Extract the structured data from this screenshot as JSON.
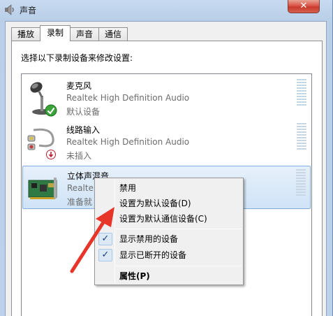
{
  "window": {
    "title": "声音",
    "close_glyph": "✕",
    "icon": "speaker-icon"
  },
  "tabs": [
    {
      "label": "播放",
      "active": false
    },
    {
      "label": "录制",
      "active": true
    },
    {
      "label": "声音",
      "active": false
    },
    {
      "label": "通信",
      "active": false
    }
  ],
  "recording": {
    "instruction": "选择以下录制设备来修改设置:",
    "devices": [
      {
        "name": "麦克风",
        "driver": "Realtek High Definition Audio",
        "status": "默认设备",
        "icon": "microphone-icon",
        "badge": "default-check-icon"
      },
      {
        "name": "线路输入",
        "driver": "Realtek High Definition Audio",
        "status": "未插入",
        "icon": "line-in-cable-icon",
        "badge": "unplugged-icon"
      },
      {
        "name": "立体声混音",
        "driver": "Realtek",
        "status": "准备就",
        "icon": "sound-card-icon",
        "selected": true
      }
    ]
  },
  "context_menu": {
    "items": [
      {
        "label": "禁用",
        "checked": false
      },
      {
        "label": "设置为默认设备(D)",
        "checked": false
      },
      {
        "label": "设置为默认通信设备(C)",
        "checked": false
      },
      {
        "label": "显示禁用的设备",
        "checked": true
      },
      {
        "label": "显示已断开的设备",
        "checked": true
      },
      {
        "label": "属性(P)",
        "checked": false,
        "bold": true
      }
    ],
    "check_glyph": "✓"
  },
  "colors": {
    "selection_bg": "#cfe3f7",
    "annotation_arrow": "#e8352a",
    "close_button": "#c73a2c"
  }
}
